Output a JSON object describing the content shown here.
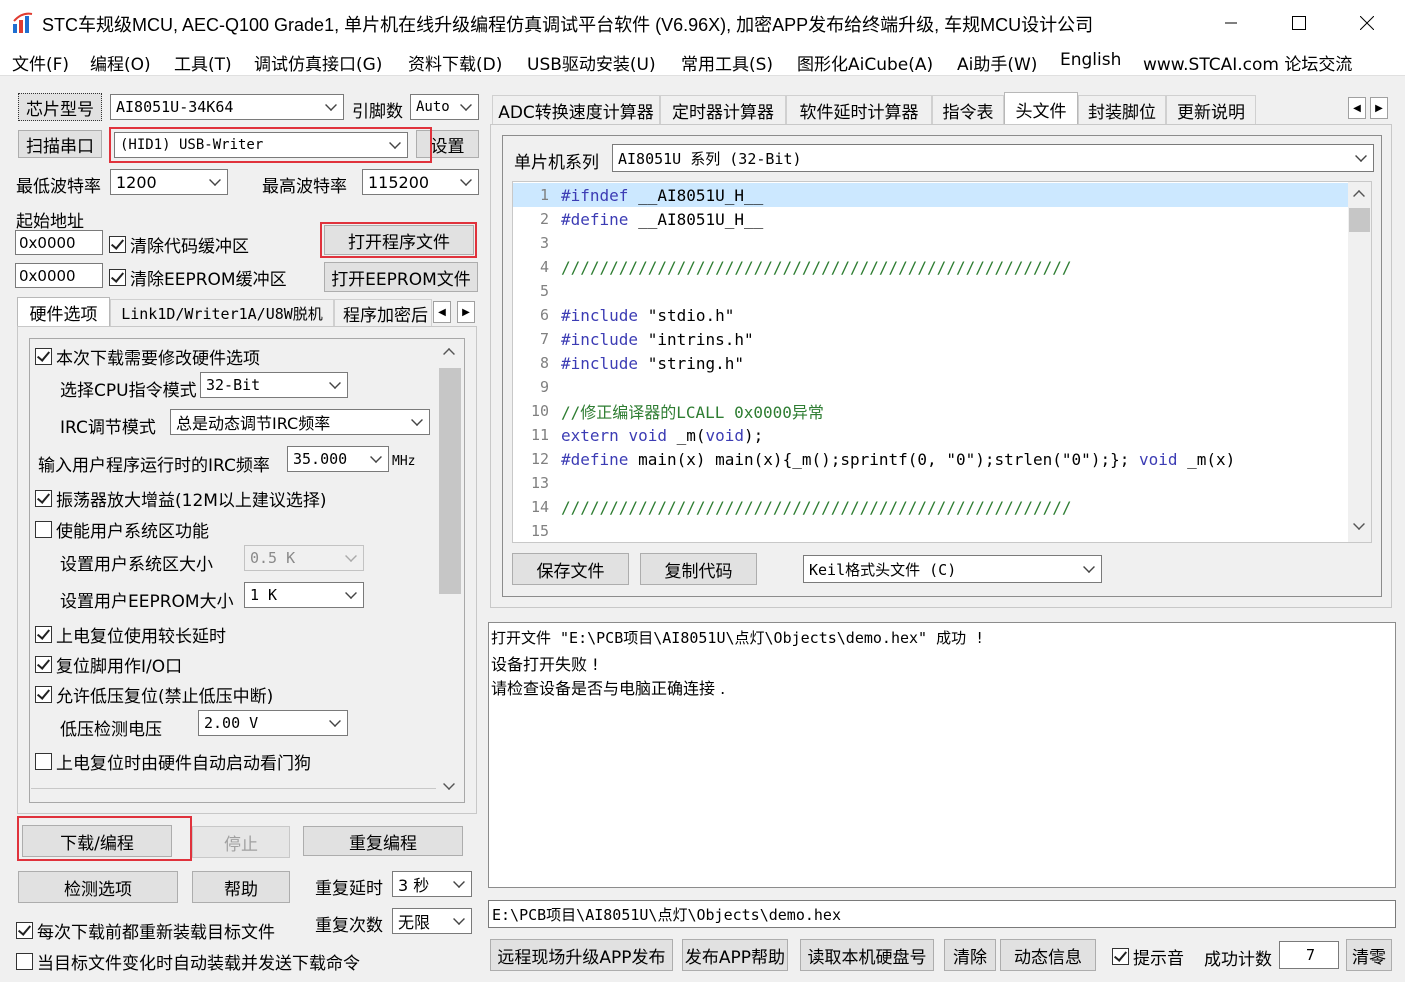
{
  "window": {
    "title": "STC车规级MCU, AEC-Q100 Grade1, 单片机在线升级编程仿真调试平台软件 (V6.96X), 加密APP发布给终端升级, 车规MCU设计公司",
    "minimize_icon": "minimize-icon",
    "maximize_icon": "maximize-icon",
    "close_icon": "close-icon"
  },
  "menu": [
    "文件(F)",
    "编程(O)",
    "工具(T)",
    "调试仿真接口(G)",
    "资料下载(D)",
    "USB驱动安装(U)",
    "常用工具(S)",
    "图形化AiCube(A)",
    "Ai助手(W)",
    "English",
    "www.STCAI.com 论坛交流"
  ],
  "left": {
    "chip_label": "芯片型号",
    "chip_value": "AI8051U-34K64",
    "pins_label": "引脚数",
    "pins_value": "Auto",
    "scan_label": "扫描串口",
    "port_value": "(HID1) USB-Writer",
    "settings_label": "设置",
    "min_baud_label": "最低波特率",
    "min_baud_value": "1200",
    "max_baud_label": "最高波特率",
    "max_baud_value": "115200",
    "start_addr_label": "起始地址",
    "addr1": "0x0000",
    "clear_code_label": "清除代码缓冲区",
    "open_prog_label": "打开程序文件",
    "addr2": "0x0000",
    "clear_eeprom_label": "清除EEPROM缓冲区",
    "open_eeprom_label": "打开EEPROM文件",
    "tabs": [
      "硬件选项",
      "Link1D/Writer1A/U8W脱机",
      "程序加密后"
    ],
    "hw": {
      "modify_hw": "本次下载需要修改硬件选项",
      "cpu_mode_label": "选择CPU指令模式",
      "cpu_mode_value": "32-Bit",
      "irc_mode_label": "IRC调节模式",
      "irc_mode_value": "总是动态调节IRC频率",
      "irc_freq_label": "输入用户程序运行时的IRC频率",
      "irc_freq_value": "35.000",
      "irc_unit": "MHz",
      "osc_gain": "振荡器放大增益(12M以上建议选择)",
      "user_sys": "使能用户系统区功能",
      "user_sys_size_label": "设置用户系统区大小",
      "user_sys_size_value": "0.5 K",
      "user_eeprom_label": "设置用户EEPROM大小",
      "user_eeprom_value": "1   K",
      "long_delay": "上电复位使用较长延时",
      "reset_io": "复位脚用作I/O口",
      "lvr": "允许低压复位(禁止低压中断)",
      "lvd_label": "低压检测电压",
      "lvd_value": "2.00 V",
      "wdt": "上电复位时由硬件自动启动看门狗"
    },
    "download_label": "下载/编程",
    "stop_label": "停止",
    "repeat_label": "重复编程",
    "detect_label": "检测选项",
    "help_label": "帮助",
    "repeat_delay_label": "重复延时",
    "repeat_delay_value": "3 秒",
    "repeat_count_label": "重复次数",
    "repeat_count_value": "无限",
    "reload_before": "每次下载前都重新装载目标文件",
    "auto_reload": "当目标文件变化时自动装载并发送下载命令"
  },
  "right": {
    "tabs": [
      "ADC转换速度计算器",
      "定时器计算器",
      "软件延时计算器",
      "指令表",
      "头文件",
      "封装脚位",
      "更新说明"
    ],
    "active_tab": "头文件",
    "series_label": "单片机系列",
    "series_value": "AI8051U 系列 (32-Bit)",
    "code_lines": [
      {
        "n": "1",
        "t": "#ifndef __AI8051U_H__"
      },
      {
        "n": "2",
        "t": "#define __AI8051U_H__"
      },
      {
        "n": "3",
        "t": ""
      },
      {
        "n": "4",
        "t": "/////////////////////////////////////////////////////"
      },
      {
        "n": "5",
        "t": ""
      },
      {
        "n": "6",
        "t": "#include \"stdio.h\""
      },
      {
        "n": "7",
        "t": "#include \"intrins.h\""
      },
      {
        "n": "8",
        "t": "#include \"string.h\""
      },
      {
        "n": "9",
        "t": ""
      },
      {
        "n": "10",
        "t": "//修正编译器的LCALL 0x0000异常"
      },
      {
        "n": "11",
        "t": "extern void _m(void);"
      },
      {
        "n": "12",
        "t": "#define main(x) main(x){_m();sprintf(0, \"0\");strlen(\"0\");}; void _m(x)"
      },
      {
        "n": "13",
        "t": ""
      },
      {
        "n": "14",
        "t": "/////////////////////////////////////////////////////"
      },
      {
        "n": "15",
        "t": ""
      }
    ],
    "save_label": "保存文件",
    "copy_label": "复制代码",
    "format_value": "Keil格式头文件 (C)",
    "log": [
      "打开文件 \"E:\\PCB项目\\AI8051U\\点灯\\Objects\\demo.hex\" 成功 !",
      "设备打开失败 !",
      "请检查设备是否与电脑正确连接 ."
    ],
    "path": "E:\\PCB项目\\AI8051U\\点灯\\Objects\\demo.hex",
    "bottom_buttons": [
      "远程现场升级APP发布",
      "发布APP帮助",
      "读取本机硬盘号",
      "清除",
      "动态信息"
    ],
    "beep_label": "提示音",
    "success_label": "成功计数",
    "success_value": "7",
    "clear_count_label": "清零"
  },
  "colors": {
    "highlight_box": "#e0323c",
    "keyword": "#3c3cb4",
    "comment": "#2e7d32",
    "current_line": "#cce8ff"
  }
}
